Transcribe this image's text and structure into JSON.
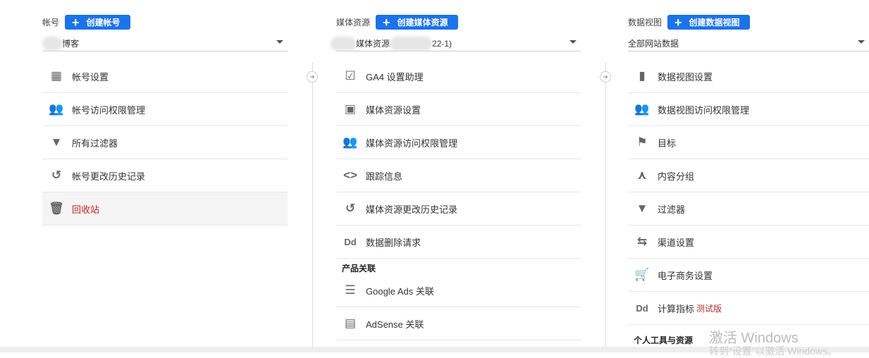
{
  "account": {
    "label": "帐号",
    "create": "创建帐号",
    "selected": "博客",
    "items": [
      {
        "icon": "building-icon",
        "label": "帐号设置"
      },
      {
        "icon": "people-icon",
        "label": "帐号访问权限管理"
      },
      {
        "icon": "filter-icon",
        "label": "所有过滤器"
      },
      {
        "icon": "history-icon",
        "label": "帐号更改历史记录"
      },
      {
        "icon": "trash-icon",
        "label": "回收站"
      }
    ]
  },
  "property": {
    "label": "媒体资源",
    "create": "创建媒体资源",
    "selected_prefix": "媒体资源",
    "selected_suffix": "22-1)",
    "items": [
      {
        "icon": "checklist-icon",
        "label": "GA4 设置助理"
      },
      {
        "icon": "layout-icon",
        "label": "媒体资源设置"
      },
      {
        "icon": "people-icon",
        "label": "媒体资源访问权限管理"
      },
      {
        "icon": "code-icon",
        "label": "跟踪信息"
      },
      {
        "icon": "history-icon",
        "label": "媒体资源更改历史记录"
      },
      {
        "icon": "dd-icon",
        "label": "数据删除请求"
      }
    ],
    "section": "产品关联",
    "links": [
      {
        "icon": "google-ads-icon",
        "label": "Google Ads 关联"
      },
      {
        "icon": "adsense-icon",
        "label": "AdSense 关联"
      }
    ]
  },
  "view": {
    "label": "数据视图",
    "create": "创建数据视图",
    "selected": "全部网站数据",
    "items": [
      {
        "icon": "document-icon",
        "label": "数据视图设置"
      },
      {
        "icon": "people-icon",
        "label": "数据视图访问权限管理"
      },
      {
        "icon": "flag-icon",
        "label": "目标"
      },
      {
        "icon": "merge-icon",
        "label": "内容分组"
      },
      {
        "icon": "filter-icon",
        "label": "过滤器"
      },
      {
        "icon": "channel-icon",
        "label": "渠道设置"
      },
      {
        "icon": "cart-icon",
        "label": "电子商务设置"
      },
      {
        "icon": "dd-icon",
        "label": "计算指标",
        "badge": "测试版"
      }
    ],
    "section": "个人工具与资源"
  },
  "glyphs": {
    "building": "▦",
    "people": "👥",
    "filter": "▼",
    "history": "↺",
    "trash": "🗑",
    "check": "☑",
    "layout": "▣",
    "code": "<>",
    "dd": "Dd",
    "ads": "☰",
    "adsense": "▤",
    "doc": "▮",
    "flag": "⚑",
    "merge": "⋏",
    "channel": "⇆",
    "cart": "🛒",
    "arrow": "➜"
  },
  "watermark": {
    "title": "激活 Windows",
    "sub": "转到“设置”以激活 Windows。"
  }
}
